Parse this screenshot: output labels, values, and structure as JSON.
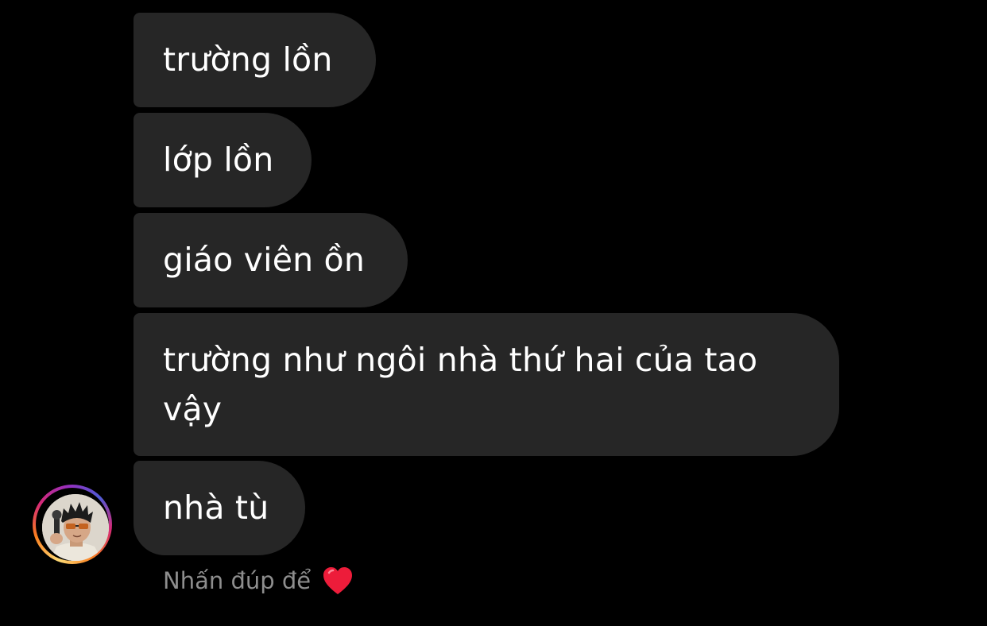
{
  "messages": [
    {
      "text": "trường lồn"
    },
    {
      "text": "lớp lồn"
    },
    {
      "text": "giáo viên ồn"
    },
    {
      "text_line1": "trường như ngôi nhà thứ hai của tao",
      "text_line2": "vậy"
    },
    {
      "text": "nhà tù"
    }
  ],
  "hint": {
    "text": "Nhấn đúp để",
    "icon": "heart-icon"
  },
  "colors": {
    "background": "#000000",
    "bubble": "#262626",
    "text": "#ffffff",
    "hint_text": "#8e8e8e",
    "heart": "#ed1c3a"
  }
}
